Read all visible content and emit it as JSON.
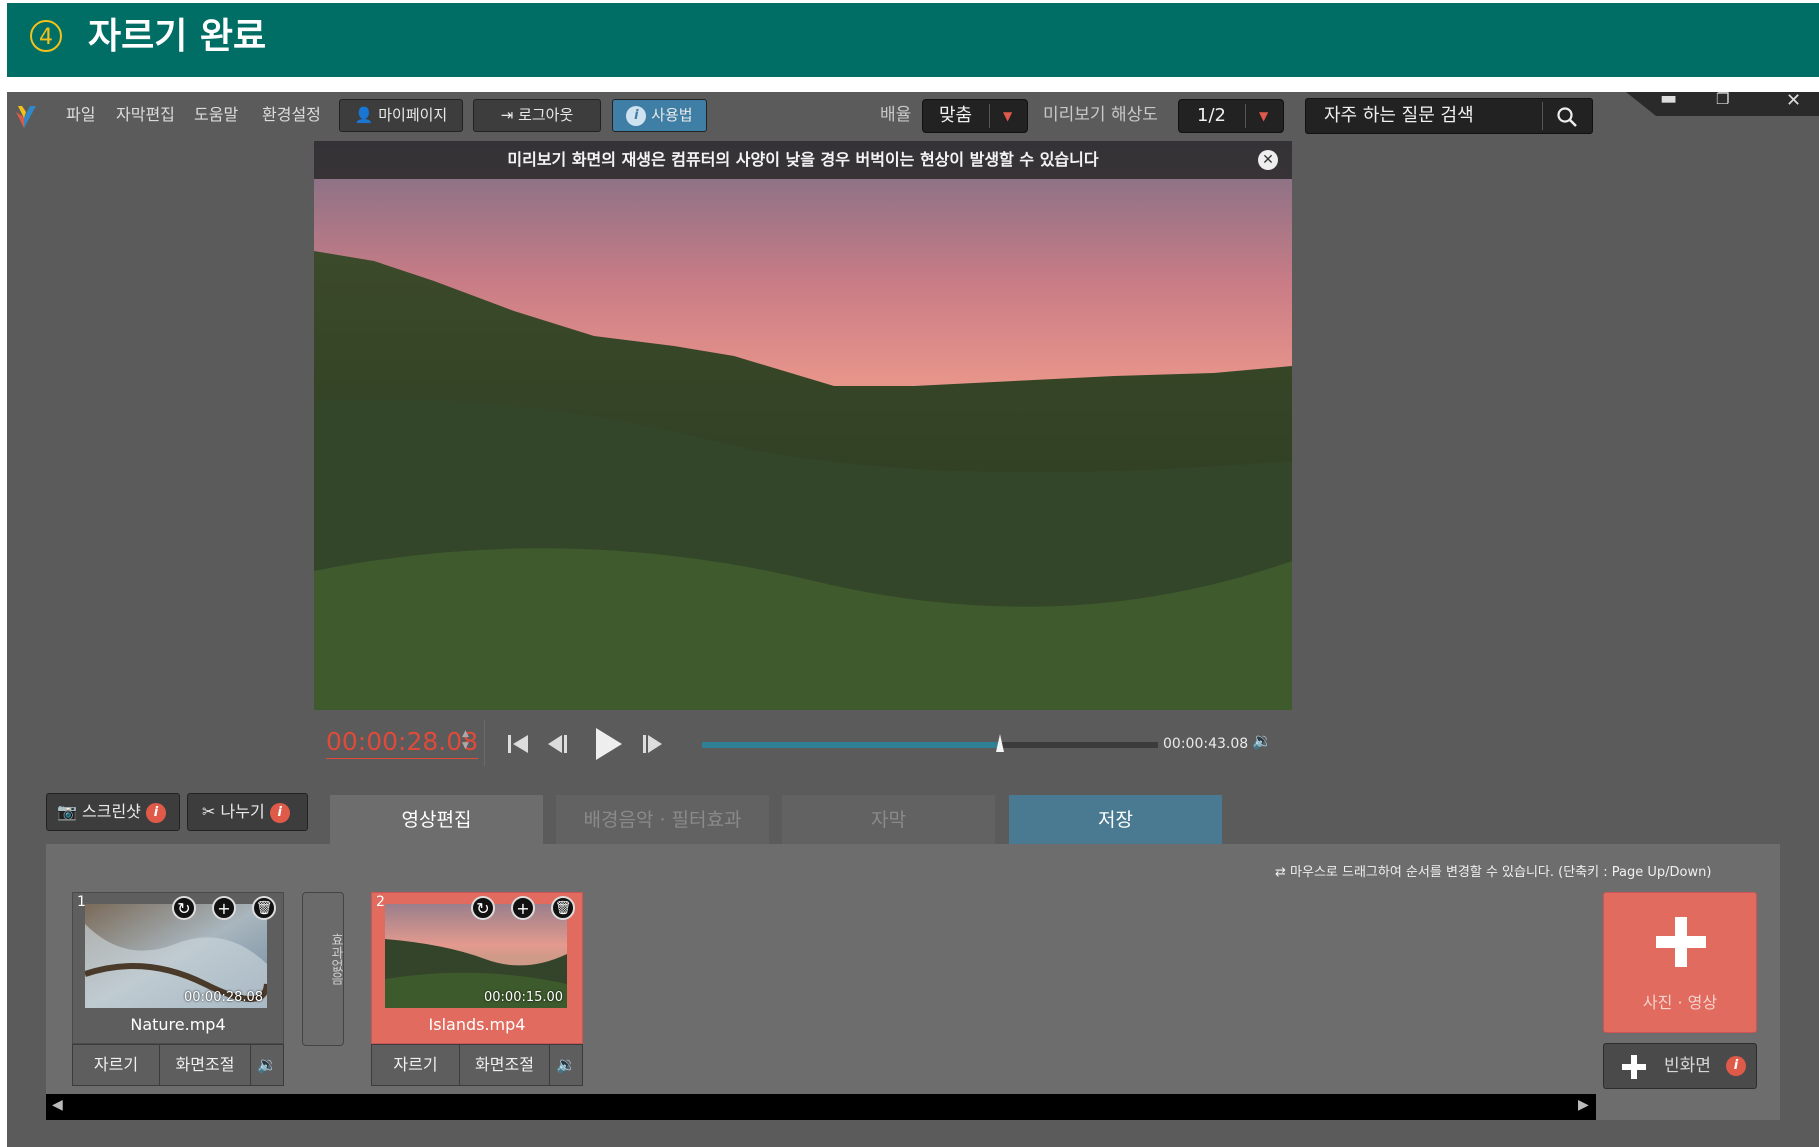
{
  "banner": {
    "step_number": "4",
    "title": "자르기 완료"
  },
  "menu": {
    "file": "파일",
    "subtitle_edit": "자막편집",
    "help": "도움말",
    "settings": "환경설정"
  },
  "header_buttons": {
    "mypage": "마이페이지",
    "logout": "로그아웃",
    "usage": "사용법"
  },
  "zoom": {
    "label": "배율",
    "value": "맞춤"
  },
  "resolution": {
    "label": "미리보기 해상도",
    "value": "1/2"
  },
  "search": {
    "placeholder": "자주 하는 질문 검색"
  },
  "preview": {
    "notice": "미리보기 화면의 재생은 컴퓨터의 사양이 낮을 경우 버벅이는 현상이 발생할 수 있습니다"
  },
  "player": {
    "current_time": "00:00:28.08",
    "total_time": "00:00:43.08",
    "progress": 0.6535
  },
  "tools": {
    "screenshot": "스크린샷",
    "split": "나누기"
  },
  "tabs": [
    {
      "label": "영상편집",
      "state": "active"
    },
    {
      "label": "배경음악 · 필터효과",
      "state": "inactive"
    },
    {
      "label": "자막",
      "state": "inactive"
    },
    {
      "label": "저장",
      "state": "save"
    }
  ],
  "timeline": {
    "hint": "⇄ 마우스로 드래그하여 순서를 변경할 수 있습니다. (단축키 : Page Up/Down)",
    "clips": [
      {
        "number": "1",
        "duration": "00:00:28.08",
        "name": "Nature.mp4",
        "cut": "자르기",
        "adjust": "화면조절",
        "selected": false
      },
      {
        "number": "2",
        "duration": "00:00:15.00",
        "name": "Islands.mp4",
        "cut": "자르기",
        "adjust": "화면조절",
        "selected": true
      }
    ],
    "effect_label": "효과없음",
    "add_media": "사진 · 영상",
    "blank_screen": "빈화면"
  },
  "colors": {
    "banner": "#006e64",
    "accent_red": "#e05a4a",
    "save_tab": "#3f7fa6",
    "timecode": "#e04a3a"
  }
}
